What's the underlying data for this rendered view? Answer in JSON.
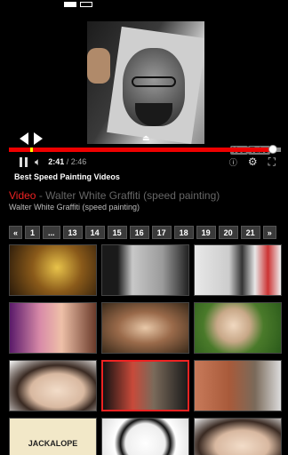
{
  "player": {
    "caption": "Best Speed Painting Videos",
    "current_time": "2:41",
    "time_separator": " / ",
    "duration": "2:46",
    "progress_fraction": 0.97,
    "buffered_fraction": 1.0,
    "logo_text": "You",
    "logo_box": "Tube"
  },
  "video": {
    "label": "Video",
    "separator": " - ",
    "title": "Walter White Graffiti (speed painting)",
    "subtitle": "Walter White Graffiti (speed painting)"
  },
  "pager": {
    "items": [
      "«",
      "1",
      "...",
      "13",
      "14",
      "15",
      "16",
      "17",
      "18",
      "19",
      "20",
      "21",
      "»"
    ]
  },
  "thumbnails": {
    "jackalope_text": "JACKALOPE"
  },
  "colors": {
    "accent": "#e22222",
    "progress": "#ee0000",
    "background": "#000000"
  }
}
